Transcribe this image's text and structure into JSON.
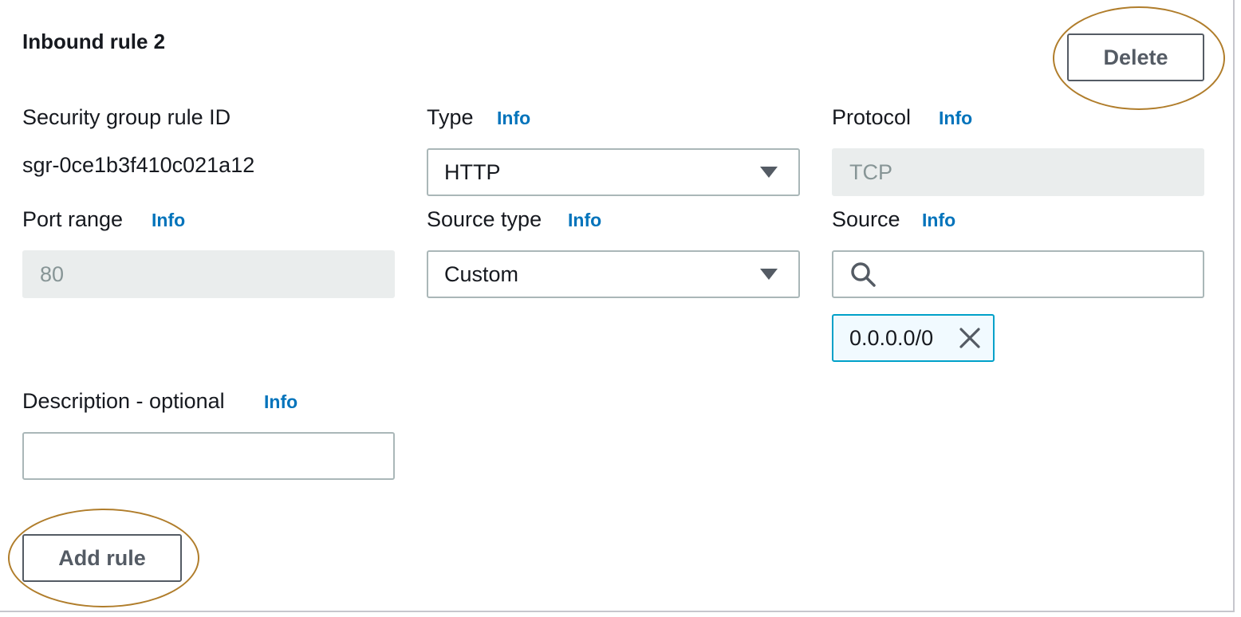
{
  "rule": {
    "title": "Inbound rule 2",
    "delete_label": "Delete",
    "add_rule_label": "Add rule"
  },
  "fields": {
    "rule_id": {
      "label": "Security group rule ID",
      "value": "sgr-0ce1b3f410c021a12"
    },
    "type": {
      "label": "Type",
      "info": "Info",
      "value": "HTTP"
    },
    "protocol": {
      "label": "Protocol",
      "info": "Info",
      "value": "TCP"
    },
    "port_range": {
      "label": "Port range",
      "info": "Info",
      "value": "80"
    },
    "source_type": {
      "label": "Source type",
      "info": "Info",
      "value": "Custom"
    },
    "source": {
      "label": "Source",
      "info": "Info",
      "value": "",
      "token": "0.0.0.0/0",
      "icon": "search-icon"
    },
    "description": {
      "label": "Description - optional",
      "info": "Info",
      "value": ""
    }
  },
  "colors": {
    "info_link": "#0073bb",
    "button_border": "#545b64",
    "highlight_circle": "#b07d2b",
    "token_border": "#00a1c9",
    "disabled_bg": "#eaeded"
  }
}
